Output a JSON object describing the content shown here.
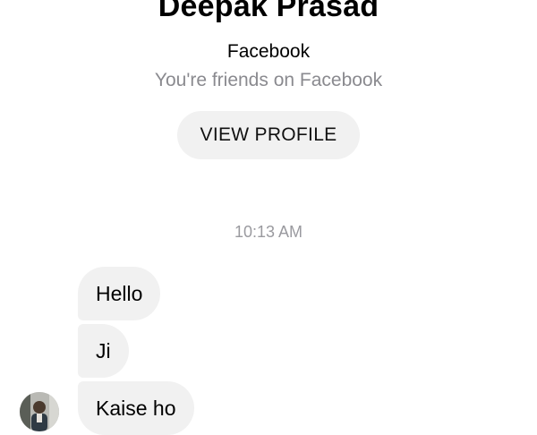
{
  "profile": {
    "name": "Deepak Prasad",
    "network": "Facebook",
    "friend_status": "You're friends on Facebook",
    "view_profile_label": "VIEW PROFILE"
  },
  "conversation": {
    "timestamp": "10:13 AM",
    "messages": [
      {
        "text": "Hello"
      },
      {
        "text": "Ji"
      },
      {
        "text": "Kaise ho"
      }
    ]
  },
  "colors": {
    "bubble_background": "#f1f1f1",
    "button_background": "#f1f1f1",
    "secondary_text": "#8a8a8f",
    "timestamp_text": "#9a9a9f"
  }
}
